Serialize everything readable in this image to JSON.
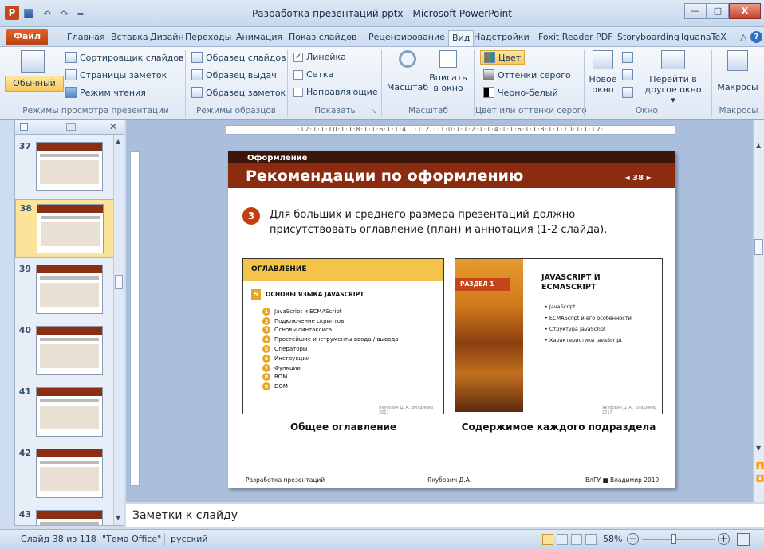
{
  "window": {
    "title": "Разработка презентаций.pptx - Microsoft PowerPoint",
    "app_icon": "P",
    "minimize": "—",
    "maximize": "□",
    "close": "X"
  },
  "quick_access": {
    "undo": "↶",
    "redo": "↷",
    "dropdown": "="
  },
  "tabs": [
    "Главная",
    "Вставка",
    "Дизайн",
    "Переходы",
    "Анимация",
    "Показ слайдов",
    "Рецензирование",
    "Вид",
    "Надстройки",
    "Foxit Reader PDF",
    "Storyboarding",
    "IguanaTeX"
  ],
  "file_tab": "Файл",
  "active_tab": "Вид",
  "ribbon": {
    "views": {
      "label": "Режимы просмотра презентации",
      "normal": "Обычный",
      "sorter": "Сортировщик слайдов",
      "notes_page": "Страницы заметок",
      "reading": "Режим чтения"
    },
    "masters": {
      "label": "Режимы образцов",
      "slide_master": "Образец слайдов",
      "handout_master": "Образец выдач",
      "notes_master": "Образец заметок"
    },
    "show": {
      "label": "Показать",
      "ruler": "Линейка",
      "grid": "Сетка",
      "guides": "Направляющие",
      "ruler_checked": true,
      "grid_checked": false,
      "guides_checked": false
    },
    "zoom": {
      "label": "Масштаб",
      "zoom": "Масштаб",
      "fit_line1": "Вписать",
      "fit_line2": "в окно"
    },
    "color": {
      "label": "Цвет или оттенки серого",
      "color": "Цвет",
      "grayscale": "Оттенки серого",
      "bw": "Черно-белый"
    },
    "window": {
      "label": "Окно",
      "new_line1": "Новое",
      "new_line2": "окно",
      "switch_line1": "Перейти в",
      "switch_line2": "другое окно ▾"
    },
    "macros": {
      "label": "Макросы",
      "macros": "Макросы"
    }
  },
  "thumbnails": [
    {
      "num": "37",
      "selected": false
    },
    {
      "num": "38",
      "selected": true
    },
    {
      "num": "39",
      "selected": false
    },
    {
      "num": "40",
      "selected": false
    },
    {
      "num": "41",
      "selected": false
    },
    {
      "num": "42",
      "selected": false
    },
    {
      "num": "43",
      "selected": false
    }
  ],
  "ruler_text": "·12·1·1·10·1·1·8·1·1·6·1·1·4·1·1·2·1·1·0·1·1·2·1·1·4·1·1·6·1·1·8·1·1·10·1·1·12·",
  "slide": {
    "section": "Оформление",
    "title": "Рекомендации по оформлению",
    "nav": "◄ 38 ►",
    "bullet_num": "3",
    "body": "Для больших и среднего размера презентаций должно присутствовать оглавление (план) и аннотация (1-2 слайда).",
    "toc": {
      "header": "ОГЛАВЛЕНИЕ",
      "subtitle": "ОСНОВЫ ЯЗЫКА JAVASCRIPT",
      "js_badge": "5",
      "items": [
        {
          "n": "1",
          "t": "JavaScript и ECMAScript"
        },
        {
          "n": "2",
          "t": "Подключение скриптов"
        },
        {
          "n": "3",
          "t": "Основы синтаксиса"
        },
        {
          "n": "4",
          "t": "Простейшие инструменты ввода / вывода"
        },
        {
          "n": "5",
          "t": "Операторы"
        },
        {
          "n": "6",
          "t": "Инструкции"
        },
        {
          "n": "7",
          "t": "Функции"
        },
        {
          "n": "8",
          "t": "BOM"
        },
        {
          "n": "9",
          "t": "DOM"
        }
      ],
      "author": "Якубович Д. А., Владимир 2017"
    },
    "section_box": {
      "badge": "РАЗДЕЛ 1",
      "title": "JAVASCRIPT И ECMASCRIPT",
      "items": [
        "JavaScript",
        "ECMAScript и его особенности",
        "Структура JavaScript",
        "Характеристики JavaScript"
      ],
      "author": "Якубович Д. А., Владимир 2017"
    },
    "caption_left": "Общее оглавление",
    "caption_right": "Содержимое каждого подраздела",
    "footer_left": "Разработка презентаций",
    "footer_center": "Якубович Д.А.",
    "footer_right": "ВлГУ ■ Владимир 2019"
  },
  "notes_placeholder": "Заметки к слайду",
  "status": {
    "slide_info": "Слайд 38 из 118",
    "theme": "\"Тема Office\"",
    "language": "русский",
    "zoom": "58%",
    "minus": "−",
    "plus": "+"
  }
}
